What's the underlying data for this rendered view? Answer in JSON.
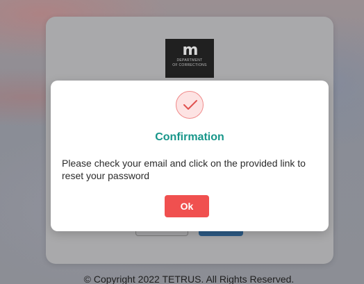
{
  "background": {
    "logo": {
      "mark": "m",
      "line1": "DEPARTMENT",
      "line2": "OF CORRECTIONS"
    },
    "copyright": "© Copyright 2022 TETRUS. All Rights Reserved."
  },
  "modal": {
    "icon": "checkmark-icon",
    "title": "Confirmation",
    "message": "Please check your email and click on the provided link to reset your password",
    "ok_label": "Ok"
  },
  "colors": {
    "accent_title": "#17968a",
    "ok_button": "#f0504f",
    "icon_ring": "#f08a8a"
  }
}
